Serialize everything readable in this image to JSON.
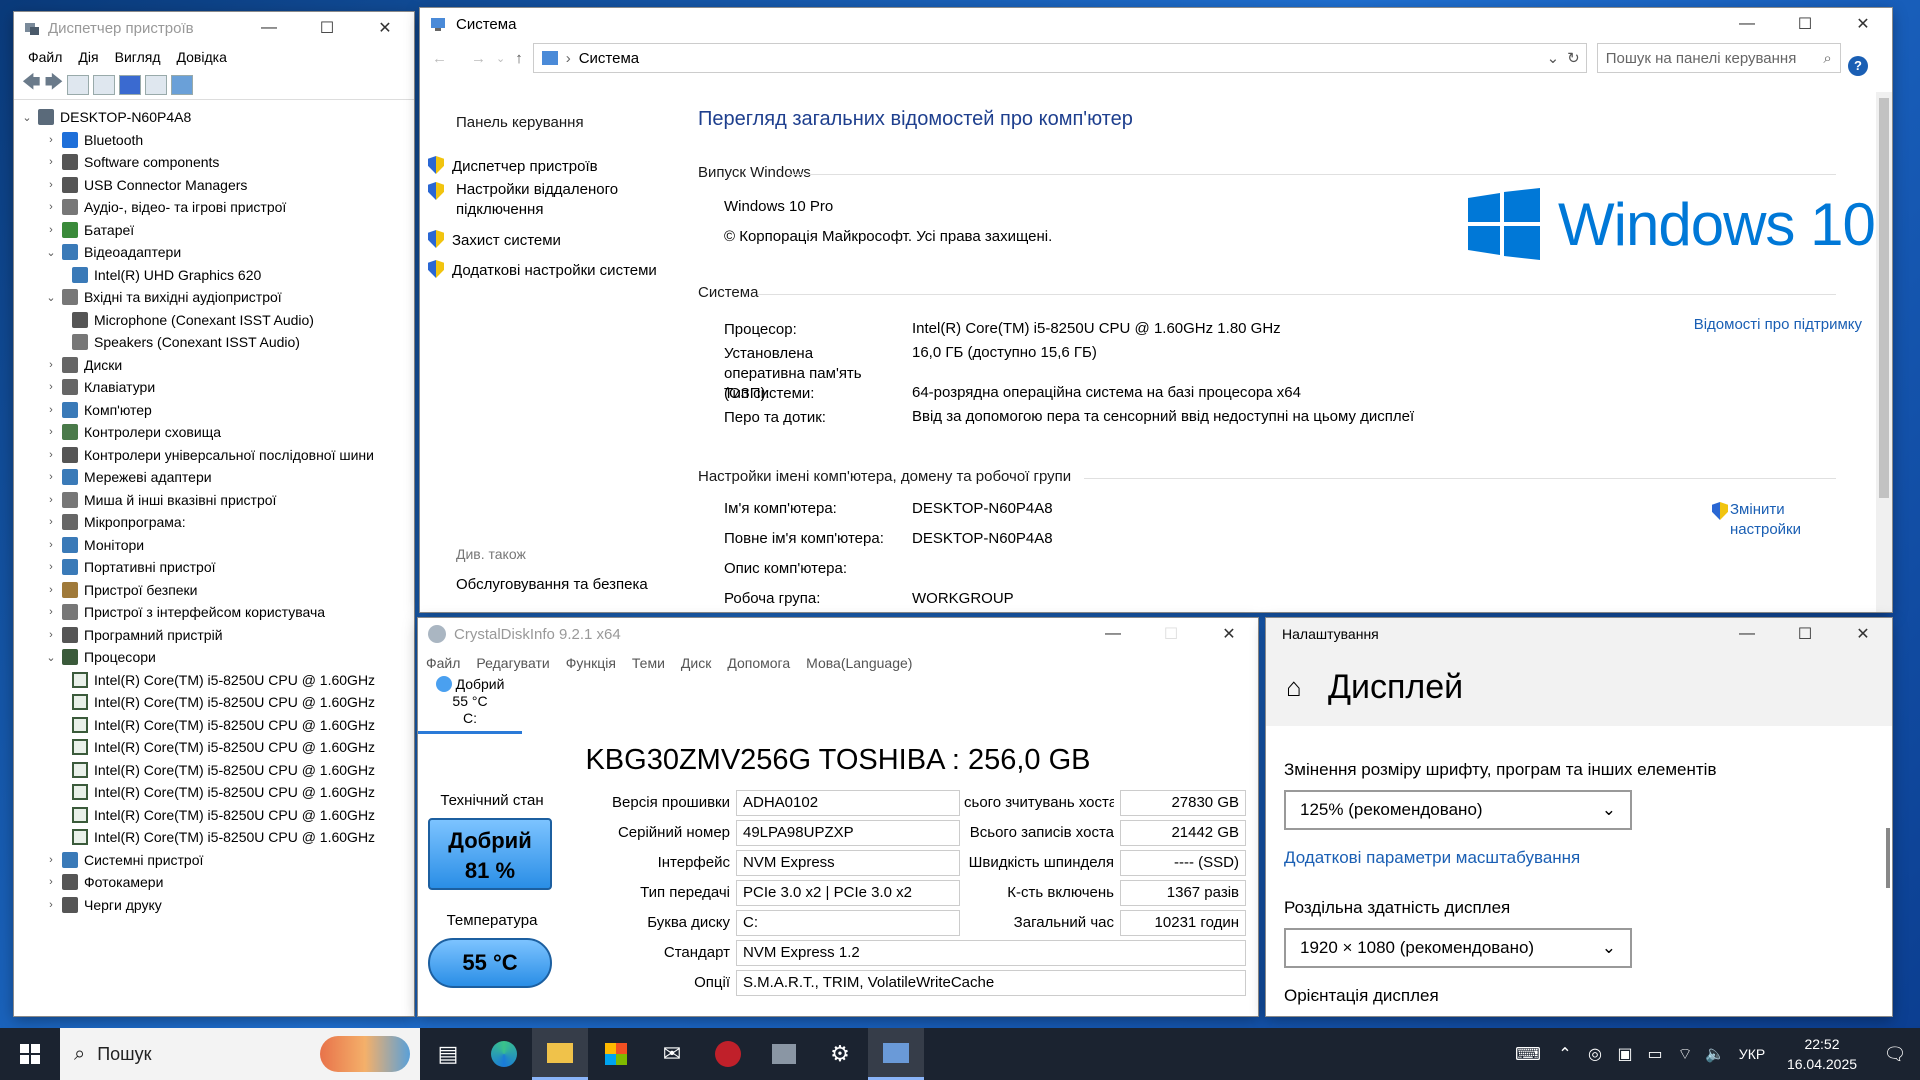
{
  "device_manager": {
    "title": "Диспетчер пристроїв",
    "menu": [
      "Файл",
      "Дія",
      "Вигляд",
      "Довідка"
    ],
    "root": "DESKTOP-N60P4A8",
    "tree": [
      {
        "label": "Bluetooth",
        "expanded": false,
        "level": 1,
        "icon": "bluetooth-icon",
        "color": "#1e6fd9"
      },
      {
        "label": "Software components",
        "expanded": false,
        "level": 1,
        "icon": "software-component-icon",
        "color": "#555555"
      },
      {
        "label": "USB Connector Managers",
        "expanded": false,
        "level": 1,
        "icon": "usb-icon",
        "color": "#555555"
      },
      {
        "label": "Аудіо-, відео- та ігрові пристрої",
        "expanded": false,
        "level": 1,
        "icon": "speaker-icon",
        "color": "#777777"
      },
      {
        "label": "Батареї",
        "expanded": false,
        "level": 1,
        "icon": "battery-icon",
        "color": "#3a8a3a"
      },
      {
        "label": "Відеоадаптери",
        "expanded": true,
        "level": 1,
        "icon": "display-adapter-icon",
        "color": "#3a7ab8"
      },
      {
        "label": "Intel(R) UHD Graphics 620",
        "level": 2,
        "icon": "display-adapter-icon",
        "color": "#3a7ab8"
      },
      {
        "label": "Вхідні та вихідні аудіопристрої",
        "expanded": true,
        "level": 1,
        "icon": "speaker-icon",
        "color": "#777777"
      },
      {
        "label": "Microphone (Conexant ISST Audio)",
        "level": 2,
        "icon": "microphone-icon",
        "color": "#555555"
      },
      {
        "label": "Speakers (Conexant ISST Audio)",
        "level": 2,
        "icon": "speaker-icon",
        "color": "#777777"
      },
      {
        "label": "Диски",
        "expanded": false,
        "level": 1,
        "icon": "disk-icon",
        "color": "#666666"
      },
      {
        "label": "Клавіатури",
        "expanded": false,
        "level": 1,
        "icon": "keyboard-icon",
        "color": "#666666"
      },
      {
        "label": "Комп'ютер",
        "expanded": false,
        "level": 1,
        "icon": "computer-icon",
        "color": "#3a7ab8"
      },
      {
        "label": "Контролери сховища",
        "expanded": false,
        "level": 1,
        "icon": "storage-controller-icon",
        "color": "#4a7a4a"
      },
      {
        "label": "Контролери універсальної послідовної шини",
        "expanded": false,
        "level": 1,
        "icon": "usb-icon",
        "color": "#555555"
      },
      {
        "label": "Мережеві адаптери",
        "expanded": false,
        "level": 1,
        "icon": "network-adapter-icon",
        "color": "#3a7ab8"
      },
      {
        "label": "Миша й інші вказівні пристрої",
        "expanded": false,
        "level": 1,
        "icon": "mouse-icon",
        "color": "#777777"
      },
      {
        "label": "Мікропрограма:",
        "expanded": false,
        "level": 1,
        "icon": "firmware-icon",
        "color": "#666666"
      },
      {
        "label": "Монітори",
        "expanded": false,
        "level": 1,
        "icon": "monitor-icon",
        "color": "#3a7ab8"
      },
      {
        "label": "Портативні пристрої",
        "expanded": false,
        "level": 1,
        "icon": "portable-device-icon",
        "color": "#3a7ab8"
      },
      {
        "label": "Пристрої безпеки",
        "expanded": false,
        "level": 1,
        "icon": "security-device-icon",
        "color": "#a07a3a"
      },
      {
        "label": "Пристрої з інтерфейсом користувача",
        "expanded": false,
        "level": 1,
        "icon": "hid-icon",
        "color": "#777777"
      },
      {
        "label": "Програмний пристрій",
        "expanded": false,
        "level": 1,
        "icon": "software-device-icon",
        "color": "#555555"
      },
      {
        "label": "Процесори",
        "expanded": true,
        "level": 1,
        "icon": "processor-icon",
        "color": "#3a5a3a"
      },
      {
        "label": "Intel(R) Core(TM) i5-8250U CPU @ 1.60GHz",
        "level": 2,
        "icon": "processor-icon"
      },
      {
        "label": "Intel(R) Core(TM) i5-8250U CPU @ 1.60GHz",
        "level": 2,
        "icon": "processor-icon"
      },
      {
        "label": "Intel(R) Core(TM) i5-8250U CPU @ 1.60GHz",
        "level": 2,
        "icon": "processor-icon"
      },
      {
        "label": "Intel(R) Core(TM) i5-8250U CPU @ 1.60GHz",
        "level": 2,
        "icon": "processor-icon"
      },
      {
        "label": "Intel(R) Core(TM) i5-8250U CPU @ 1.60GHz",
        "level": 2,
        "icon": "processor-icon"
      },
      {
        "label": "Intel(R) Core(TM) i5-8250U CPU @ 1.60GHz",
        "level": 2,
        "icon": "processor-icon"
      },
      {
        "label": "Intel(R) Core(TM) i5-8250U CPU @ 1.60GHz",
        "level": 2,
        "icon": "processor-icon"
      },
      {
        "label": "Intel(R) Core(TM) i5-8250U CPU @ 1.60GHz",
        "level": 2,
        "icon": "processor-icon"
      },
      {
        "label": "Системні пристрої",
        "expanded": false,
        "level": 1,
        "icon": "system-device-icon",
        "color": "#3a7ab8"
      },
      {
        "label": "Фотокамери",
        "expanded": false,
        "level": 1,
        "icon": "camera-icon",
        "color": "#555555"
      },
      {
        "label": "Черги друку",
        "expanded": false,
        "level": 1,
        "icon": "printer-icon",
        "color": "#555555"
      }
    ]
  },
  "system": {
    "title": "Система",
    "breadcrumb": "Система",
    "search_placeholder": "Пошук на панелі керування",
    "left": {
      "home": "Панель керування",
      "links": [
        "Диспетчер пристроїв",
        "Настройки віддаленого підключення",
        "Захист системи",
        "Додаткові настройки системи"
      ],
      "see_also": "Див. також",
      "see_also_link": "Обслуговування та безпека"
    },
    "heading": "Перегляд загальних відомостей про комп'ютер",
    "edition_section": "Випуск Windows",
    "edition": "Windows 10 Pro",
    "copyright": "© Корпорація Майкрософт. Усі права захищені.",
    "logo_text": "Windows 10",
    "system_section": "Система",
    "rows": [
      {
        "label": "Процесор:",
        "value": "Intel(R) Core(TM) i5-8250U CPU @ 1.60GHz   1.80 GHz"
      },
      {
        "label": "Установлена оперативна пам'ять (ОЗП):",
        "value": "16,0 ГБ (доступно 15,6 ГБ)"
      },
      {
        "label": "Тип системи:",
        "value": "64-розрядна операційна система на базі процесора x64"
      },
      {
        "label": "Перо та дотик:",
        "value": "Ввід за допомогою пера та сенсорний ввід недоступні на цьому дисплеї"
      }
    ],
    "support_link": "Відомості про підтримку",
    "name_section": "Настройки імені комп'ютера, домену та робочої групи",
    "name_rows": [
      {
        "label": "Ім'я комп'ютера:",
        "value": "DESKTOP-N60P4A8"
      },
      {
        "label": "Повне ім'я комп'ютера:",
        "value": "DESKTOP-N60P4A8"
      },
      {
        "label": "Опис комп'ютера:",
        "value": ""
      },
      {
        "label": "Робоча група:",
        "value": "WORKGROUP"
      }
    ],
    "change_link": "Змінити настройки",
    "help": "?"
  },
  "crystal": {
    "title": "CrystalDiskInfo 9.2.1 x64",
    "menu": [
      "Файл",
      "Редагувати",
      "Функція",
      "Теми",
      "Диск",
      "Допомога",
      "Мова(Language)"
    ],
    "tab_status": "Добрий",
    "tab_temp": "55 °C",
    "tab_drive": "C:",
    "disk_title": "KBG30ZMV256G TOSHIBA : 256,0 GB",
    "health_label": "Технічний стан",
    "health_status": "Добрий",
    "health_pct": "81 %",
    "temp_label": "Температура",
    "temp_value": "55 °C",
    "left_rows": [
      {
        "label": "Версія прошивки",
        "value": "ADHA0102"
      },
      {
        "label": "Серійний номер",
        "value": "49LPA98UPZXP"
      },
      {
        "label": "Інтерфейс",
        "value": "NVM Express"
      },
      {
        "label": "Тип передачі",
        "value": "PCIe 3.0 x2 | PCIe 3.0 x2"
      },
      {
        "label": "Буква диску",
        "value": "C:"
      }
    ],
    "right_rows": [
      {
        "label": "сього зчитувань хоста",
        "value": "27830 GB"
      },
      {
        "label": "Всього записів хоста",
        "value": "21442 GB"
      },
      {
        "label": "Швидкість шпинделя",
        "value": "---- (SSD)"
      },
      {
        "label": "К-сть включень",
        "value": "1367 разів"
      },
      {
        "label": "Загальний час",
        "value": "10231 годин"
      }
    ],
    "standard_label": "Стандарт",
    "standard_value": "NVM Express 1.2",
    "features_label": "Опції",
    "features_value": "S.M.A.R.T., TRIM, VolatileWriteCache"
  },
  "settings": {
    "title": "Налаштування",
    "page": "Дисплей",
    "scale_label": "Змінення розміру шрифту, програм та інших елементів",
    "scale_value": "125% (рекомендовано)",
    "advanced_link": "Додаткові параметри масштабування",
    "resolution_label": "Роздільна здатність дисплея",
    "resolution_value": "1920 × 1080 (рекомендовано)",
    "orientation_label": "Орієнтація дисплея"
  },
  "taskbar": {
    "search": "Пошук",
    "lang": "УКР",
    "time": "22:52",
    "date": "16.04.2025"
  },
  "colors": {
    "accent": "#1e3f8e",
    "link": "#1a5fb4",
    "win_blue": "#0078d7",
    "taskbar": "#1b2330"
  }
}
